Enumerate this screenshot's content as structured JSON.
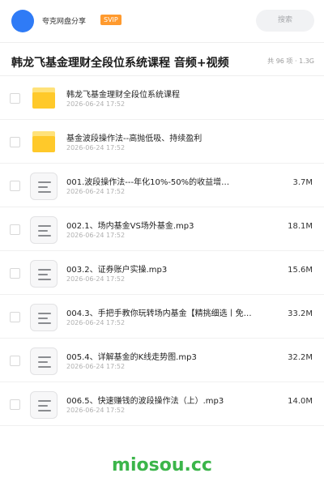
{
  "header": {
    "username": "夸克网盘分享",
    "badge": "SVIP",
    "search_placeholder": "搜索"
  },
  "title": {
    "text": "韩龙飞基金理财全段位系统课程 音频+视频",
    "meta": "共 96 项 · 1.3G"
  },
  "files": [
    {
      "type": "folder",
      "name": "韩龙飞基金理财全段位系统课程",
      "date": "2026-06-24 17:52",
      "size": ""
    },
    {
      "type": "folder",
      "name": "基金波段操作法--高抛低吸、持续盈利",
      "date": "2026-06-24 17:52",
      "size": ""
    },
    {
      "type": "file",
      "name": "001.波段操作法---年化10%-50%的收益增…",
      "date": "2026-06-24 17:52",
      "size": "3.7M"
    },
    {
      "type": "file",
      "name": "002.1、场内基金VS场外基金.mp3",
      "date": "2026-06-24 17:52",
      "size": "18.1M"
    },
    {
      "type": "file",
      "name": "003.2、证券账户实操.mp3",
      "date": "2026-06-24 17:52",
      "size": "15.6M"
    },
    {
      "type": "file",
      "name": "004.3、手把手教你玩转场内基金【精挑细选丨免费…",
      "date": "2026-06-24 17:52",
      "size": "33.2M"
    },
    {
      "type": "file",
      "name": "005.4、详解基金的K线走势图.mp3",
      "date": "2026-06-24 17:52",
      "size": "32.2M"
    },
    {
      "type": "file",
      "name": "006.5、快速赚钱的波段操作法（上）.mp3",
      "date": "2026-06-24 17:52",
      "size": "14.0M"
    }
  ],
  "watermark": "miosou.cc",
  "colors": {
    "avatar": "#2f7bf6",
    "badge": "#ff9a2e",
    "folder": "#ffc92a",
    "watermark": "#3bb54a"
  }
}
